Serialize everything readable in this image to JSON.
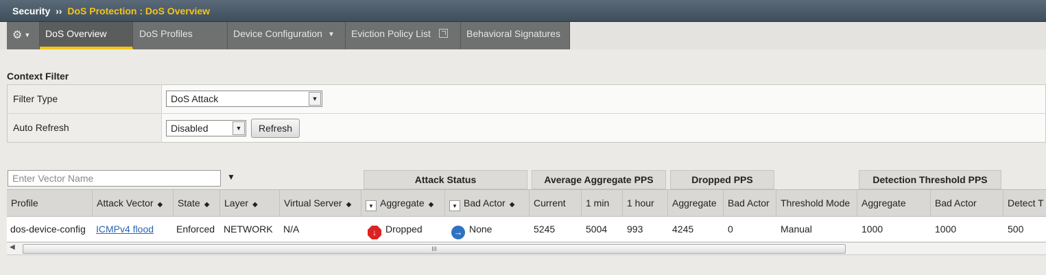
{
  "titlebar": {
    "section": "Security",
    "separator": "››",
    "crumb": "DoS Protection : DoS Overview"
  },
  "tabs": [
    {
      "label": "DoS Overview",
      "active": true
    },
    {
      "label": "DoS Profiles"
    },
    {
      "label": "Device Configuration",
      "has_caret": true
    },
    {
      "label": "Eviction Policy List",
      "external": true
    },
    {
      "label": "Behavioral Signatures"
    }
  ],
  "context_filter": {
    "title": "Context Filter",
    "filter_type": {
      "label": "Filter Type",
      "value": "DoS Attack"
    },
    "auto_refresh": {
      "label": "Auto Refresh",
      "value": "Disabled",
      "button": "Refresh"
    }
  },
  "vector_search": {
    "placeholder": "Enter Vector Name"
  },
  "group_headers": [
    "Attack Status",
    "Average Aggregate PPS",
    "Dropped PPS",
    "Detection Threshold PPS"
  ],
  "columns": [
    "Profile",
    "Attack Vector",
    "State",
    "Layer",
    "Virtual Server",
    "Aggregate",
    "Bad Actor",
    "Current",
    "1 min",
    "1 hour",
    "Aggregate",
    "Bad Actor",
    "Threshold Mode",
    "Aggregate",
    "Bad Actor",
    "Detect T"
  ],
  "row": {
    "profile": "dos-device-config",
    "attack_vector": "ICMPv4 flood",
    "state": "Enforced",
    "layer": "NETWORK",
    "virtual_server": "N/A",
    "attack_aggregate": "Dropped",
    "attack_bad_actor": "None",
    "avg_current": "5245",
    "avg_1min": "5004",
    "avg_1hour": "993",
    "dropped_aggregate": "4245",
    "dropped_bad_actor": "0",
    "threshold_mode": "Manual",
    "det_aggregate": "1000",
    "det_bad_actor": "1000",
    "detect_t": "500"
  },
  "scroll_grip": "III",
  "colors": {
    "accent": "#f5c518",
    "tab_bg": "#6f7070",
    "dropped": "#dd2222",
    "none": "#2e72c2"
  }
}
